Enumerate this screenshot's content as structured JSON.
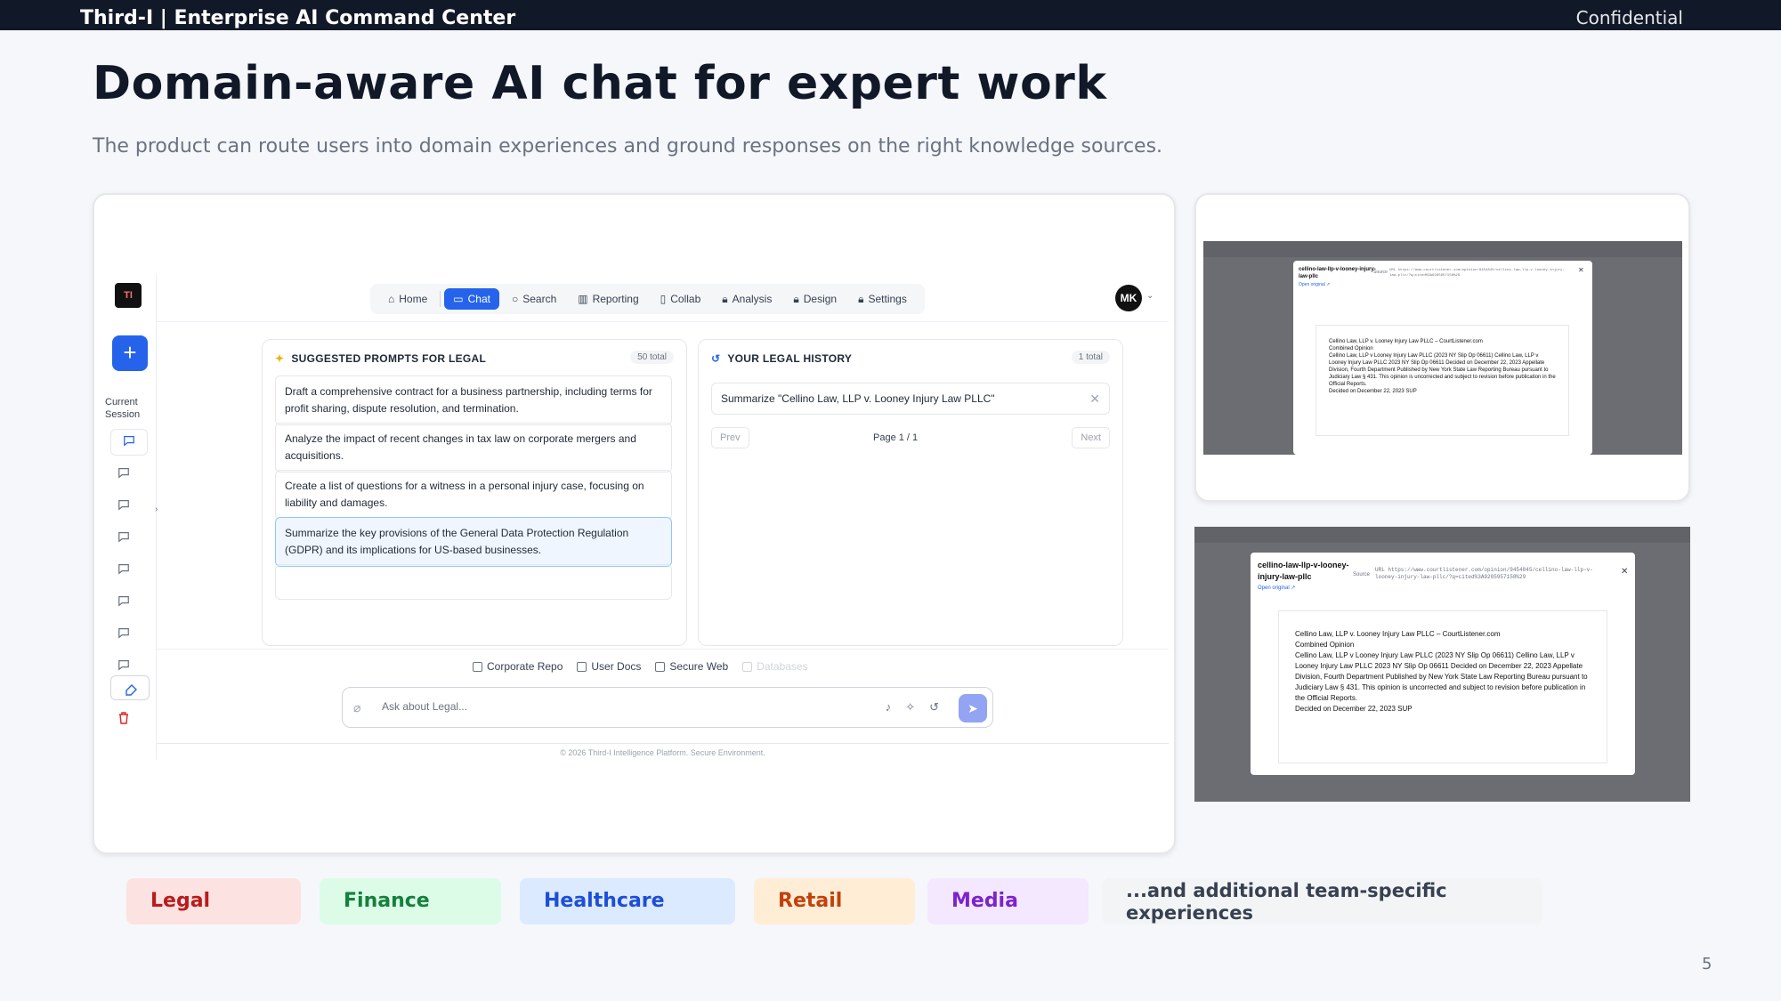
{
  "header": {
    "brand": "Third-I | Enterprise AI Command Center",
    "confidential": "Confidential"
  },
  "slide": {
    "title": "Domain-aware AI chat for expert work",
    "subtitle": "The product can route users into domain experiences and ground responses on the right knowledge sources.",
    "page_number": "5"
  },
  "app": {
    "logo": "TI",
    "current_session": "Current Session",
    "nav": [
      {
        "label": "Home",
        "icon": "home-icon"
      },
      {
        "label": "Chat",
        "icon": "chat-icon",
        "active": true
      },
      {
        "label": "Search",
        "icon": "search-icon"
      },
      {
        "label": "Reporting",
        "icon": "bar-chart-icon"
      },
      {
        "label": "Collab",
        "icon": "document-icon"
      },
      {
        "label": "Analysis",
        "icon": "lock-icon"
      },
      {
        "label": "Design",
        "icon": "lock-icon"
      },
      {
        "label": "Settings",
        "icon": "lock-icon"
      }
    ],
    "avatar": "MK",
    "prompts": {
      "title": "SUGGESTED PROMPTS FOR LEGAL",
      "count": "50 total",
      "items": [
        "Draft a comprehensive contract for a business partnership, including terms for profit sharing, dispute resolution, and termination.",
        "Analyze the impact of recent changes in tax law on corporate mergers and acquisitions.",
        "Create a list of questions for a witness in a personal injury case, focusing on liability and damages.",
        "Summarize the key provisions of the General Data Protection Regulation (GDPR) and its implications for US-based businesses."
      ]
    },
    "history": {
      "title": "YOUR LEGAL HISTORY",
      "count": "1 total",
      "item": "Summarize \"Cellino Law, LLP v. Looney Injury Law PLLC\"",
      "prev": "Prev",
      "page": "Page 1 / 1",
      "next": "Next"
    },
    "sources": [
      {
        "label": "Corporate Repo",
        "enabled": true
      },
      {
        "label": "User Docs",
        "enabled": true
      },
      {
        "label": "Secure Web",
        "enabled": true
      },
      {
        "label": "Databases",
        "enabled": false
      }
    ],
    "ask_placeholder": "Ask about Legal...",
    "footer": "© 2026 Third-I Intelligence Platform. Secure Environment."
  },
  "modal": {
    "title": "cellino-law-llp-v-looney-injury-law-pllc",
    "open_original": "Open original ↗",
    "source_label": "Source",
    "url": "URL https://www.courtlistener.com/opinion/9454845/cellino-law-llp-v-looney-injury-law-pllc/?q=cited%3A9285957158%29",
    "doc_lines": [
      "Cellino Law, LLP v. Looney Injury Law PLLC – CourtListener.com",
      "Combined Opinion",
      "Cellino Law, LLP v Looney Injury Law PLLC (2023 NY Slip Op 06611) Cellino Law, LLP v Looney Injury Law PLLC 2023 NY Slip Op 06611 Decided on December 22, 2023 Appellate Division, Fourth Department Published by New York State Law Reporting Bureau pursuant to Judiciary Law § 431. This opinion is uncorrected and subject to revision before publication in the Official Reports.",
      "Decided on December 22, 2023 SUP"
    ]
  },
  "domains": [
    {
      "label": "Legal",
      "bg": "#fde2e2",
      "color": "#b91c1c"
    },
    {
      "label": "Finance",
      "bg": "#dcfce7",
      "color": "#15803d"
    },
    {
      "label": "Healthcare",
      "bg": "#dbeafe",
      "color": "#1d4ed8"
    },
    {
      "label": "Retail",
      "bg": "#ffedd5",
      "color": "#c2410c"
    },
    {
      "label": "Media",
      "bg": "#f3e8ff",
      "color": "#7e22ce"
    }
  ],
  "domains_more": "...and additional team-specific experiences",
  "colors": {
    "accent": "#2563eb",
    "topbar": "#111827"
  }
}
